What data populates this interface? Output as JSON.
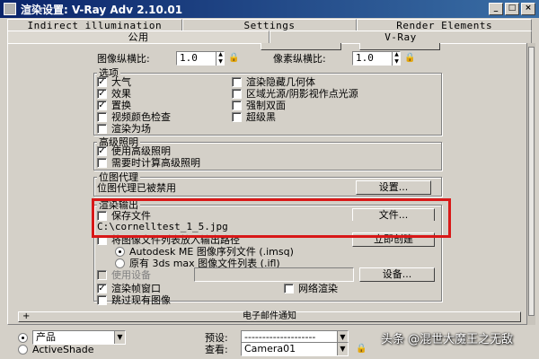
{
  "window": {
    "title": "渲染设置: V-Ray Adv 2.10.01",
    "min_label": "_",
    "max_label": "□",
    "close_label": "×"
  },
  "tabs_top": [
    "Indirect illumination",
    "Settings",
    "Render Elements"
  ],
  "tabs_bottom": [
    "公用",
    "V-Ray"
  ],
  "aspect": {
    "image_label": "图像纵横比:",
    "image_value": "1.0",
    "pixel_label": "像素纵横比:",
    "pixel_value": "1.0"
  },
  "options": {
    "title": "选项",
    "left": [
      {
        "label": "大气",
        "checked": true
      },
      {
        "label": "效果",
        "checked": true
      },
      {
        "label": "置换",
        "checked": true
      },
      {
        "label": "视频颜色检查",
        "checked": false
      },
      {
        "label": "渲染为场",
        "checked": false
      }
    ],
    "right": [
      {
        "label": "渲染隐藏几何体",
        "checked": false
      },
      {
        "label": "区域光源/阴影视作点光源",
        "checked": false
      },
      {
        "label": "强制双面",
        "checked": false
      },
      {
        "label": "超级黑",
        "checked": false
      }
    ]
  },
  "advanced_lighting": {
    "title": "高级照明",
    "items": [
      {
        "label": "使用高级照明",
        "checked": true
      },
      {
        "label": "需要时计算高级照明",
        "checked": false
      }
    ]
  },
  "bitmap_proxy": {
    "title": "位图代理",
    "status": "位图代理已被禁用",
    "button": "设置..."
  },
  "render_output": {
    "title": "渲染输出",
    "save_file_label": "保存文件",
    "save_file_checked": false,
    "files_button": "文件...",
    "path": "C:\\cornelltest_1_5.jpg",
    "put_list_label": "将图像文件列表放入输出路径",
    "create_now_button": "立即创建",
    "radio_autodesk": "Autodesk ME 图像序列文件 (.imsq)",
    "radio_legacy": "原有 3ds max 图像文件列表 (.ifl)",
    "use_device_label": "使用设备",
    "device_button": "设备...",
    "frame_window_label": "渲染帧窗口",
    "frame_window_checked": true,
    "net_render_label": "网络渲染",
    "net_render_checked": false,
    "skip_existing_label": "跳过现有图像",
    "skip_existing_checked": false
  },
  "email_rollout": {
    "plus": "+",
    "label": "电子邮件通知"
  },
  "bottom": {
    "radio_product": "产品",
    "radio_activeshade": "ActiveShade",
    "preset_label": "预设:",
    "preset_value": "--------------------",
    "view_label": "查看:",
    "view_value": "Camera01"
  },
  "watermark": "头条 @混世大魔王之无敌",
  "colors": {
    "title_bar": "#0a246a",
    "highlight": "#d81818",
    "face": "#d4d0c8"
  }
}
